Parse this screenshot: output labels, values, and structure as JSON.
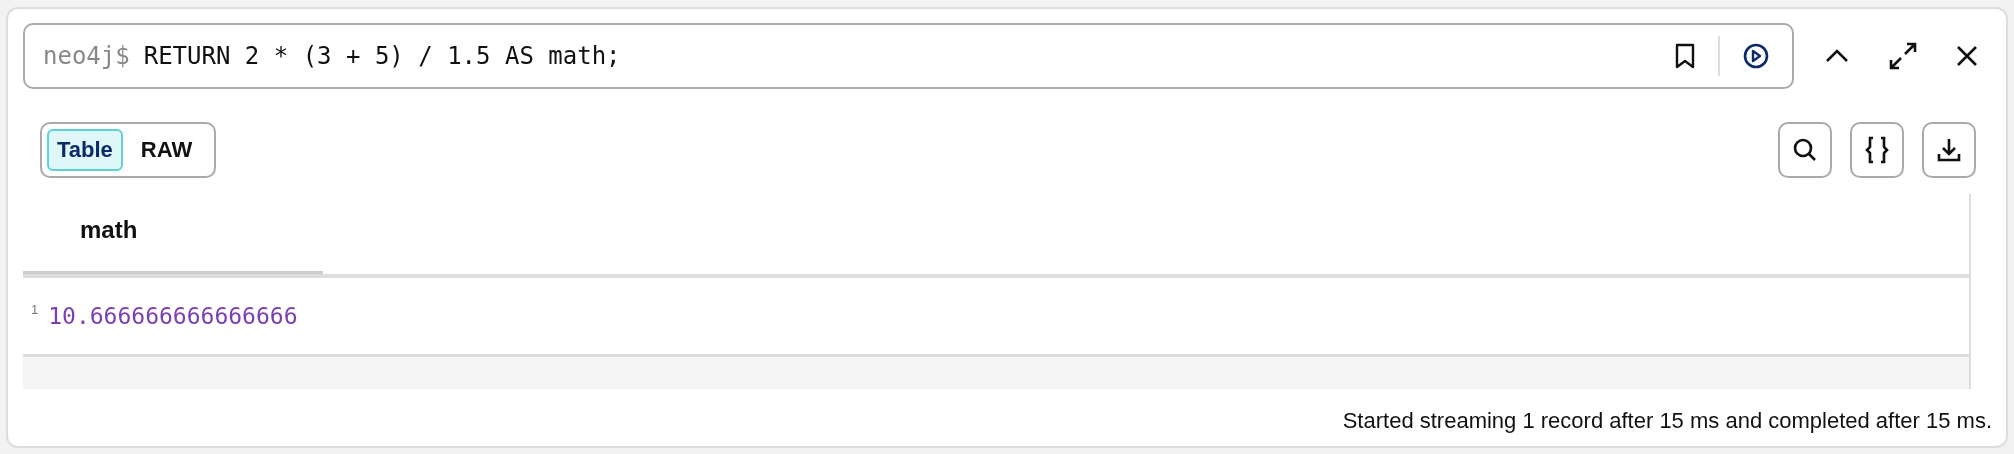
{
  "editor": {
    "prompt": "neo4j$",
    "query": "RETURN 2 * (3 + 5) / 1.5 AS math;"
  },
  "view_toggle": [
    {
      "label": "Table",
      "selected": true
    },
    {
      "label": "RAW",
      "selected": false
    }
  ],
  "table": {
    "columns": [
      "math"
    ],
    "rows": [
      {
        "index": "1",
        "cells": [
          "10.666666666666666"
        ]
      }
    ]
  },
  "status_bar": "Started streaming 1 record after 15 ms and completed after 15 ms."
}
